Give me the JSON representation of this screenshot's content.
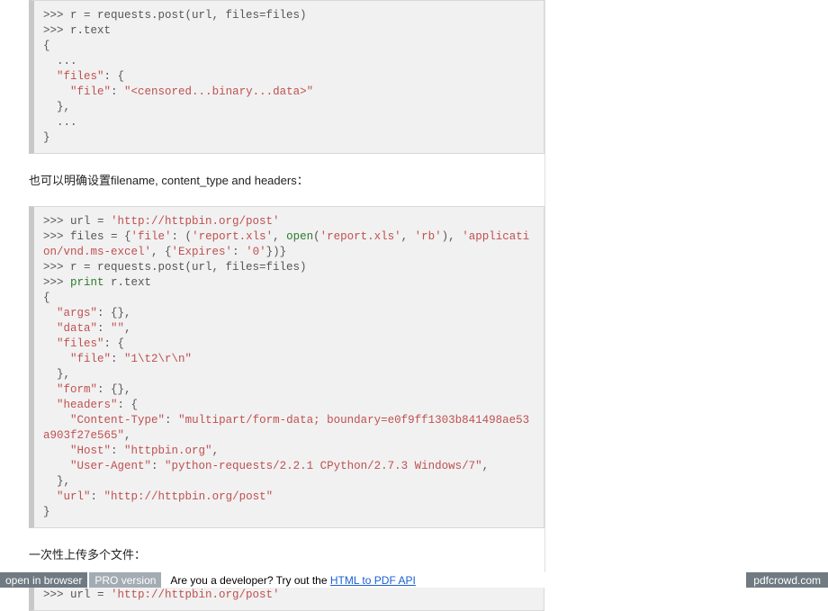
{
  "code_block_1": ">>> r = requests.post(url, files=files)\n>>> r.text\n{\n  ...\n  \"files\": {\n    \"file\": \"<censored...binary...data>\"\n  },\n  ...\n}",
  "para_1": "也可以明确设置filename, content_type and headers：",
  "code_block_2": ">>> url = 'http://httpbin.org/post'\n>>> files = {'file': ('report.xls', open('report.xls', 'rb'), 'application/vnd.ms-excel', {'Expires': '0'})}\n>>> r = requests.post(url, files=files)\n>>> print r.text\n{\n  \"args\": {},\n  \"data\": \"\",\n  \"files\": {\n    \"file\": \"1\\t2\\r\\n\"\n  },\n  \"form\": {},\n  \"headers\": {\n    \"Content-Type\": \"multipart/form-data; boundary=e0f9ff1303b841498ae53a903f27e565\",\n    \"Host\": \"httpbin.org\",\n    \"User-Agent\": \"python-requests/2.2.1 CPython/2.7.3 Windows/7\",\n  },\n  \"url\": \"http://httpbin.org/post\"\n}",
  "para_2": "一次性上传多个文件：",
  "code_block_3": ">>> url = 'http://httpbin.org/post'",
  "footer": {
    "open_label": "open in browser",
    "pro_label": "PRO version",
    "dev_text": "Are you a developer? Try out the ",
    "link_text": "HTML to PDF API",
    "brand": "pdfcrowd.com"
  }
}
